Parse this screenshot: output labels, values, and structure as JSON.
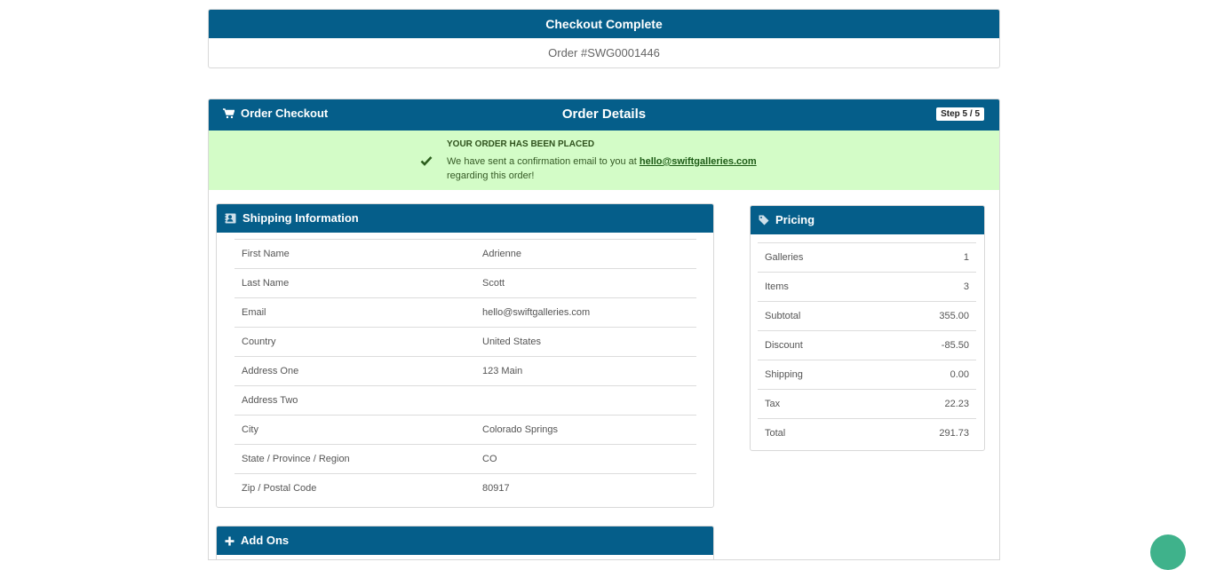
{
  "complete": {
    "title": "Checkout Complete",
    "order_number": "Order #SWG0001446"
  },
  "checkout": {
    "left_title": "Order Checkout",
    "center_title": "Order Details",
    "step": "Step 5 / 5"
  },
  "success": {
    "title": "YOUR ORDER HAS BEEN PLACED",
    "message_prefix": "We have sent a confirmation email to you at",
    "email": "hello@swiftgalleries.com",
    "message_suffix": "regarding this order!"
  },
  "shipping": {
    "title": "Shipping Information",
    "rows": [
      {
        "label": "First Name",
        "value": "Adrienne"
      },
      {
        "label": "Last Name",
        "value": "Scott"
      },
      {
        "label": "Email",
        "value": "hello@swiftgalleries.com"
      },
      {
        "label": "Country",
        "value": "United States"
      },
      {
        "label": "Address One",
        "value": "123 Main"
      },
      {
        "label": "Address Two",
        "value": ""
      },
      {
        "label": "City",
        "value": "Colorado Springs"
      },
      {
        "label": "State / Province / Region",
        "value": "CO"
      },
      {
        "label": "Zip / Postal Code",
        "value": "80917"
      }
    ]
  },
  "pricing": {
    "title": "Pricing",
    "rows": [
      {
        "label": "Galleries",
        "value": "1"
      },
      {
        "label": "Items",
        "value": "3"
      },
      {
        "label": "Subtotal",
        "value": "355.00"
      },
      {
        "label": "Discount",
        "value": "-85.50"
      },
      {
        "label": "Shipping",
        "value": "0.00"
      },
      {
        "label": "Tax",
        "value": "22.23"
      },
      {
        "label": "Total",
        "value": "291.73"
      }
    ]
  },
  "addons": {
    "title": "Add Ons"
  },
  "icons": {
    "cart": "cart-icon",
    "contact": "contact-card-icon",
    "tag": "tag-icon",
    "check": "checkmark-icon",
    "plus": "plus-icon"
  },
  "colors": {
    "header_blue": "#055e8a",
    "success_bg": "#d3fcc7",
    "help_button": "#3fb28b"
  }
}
